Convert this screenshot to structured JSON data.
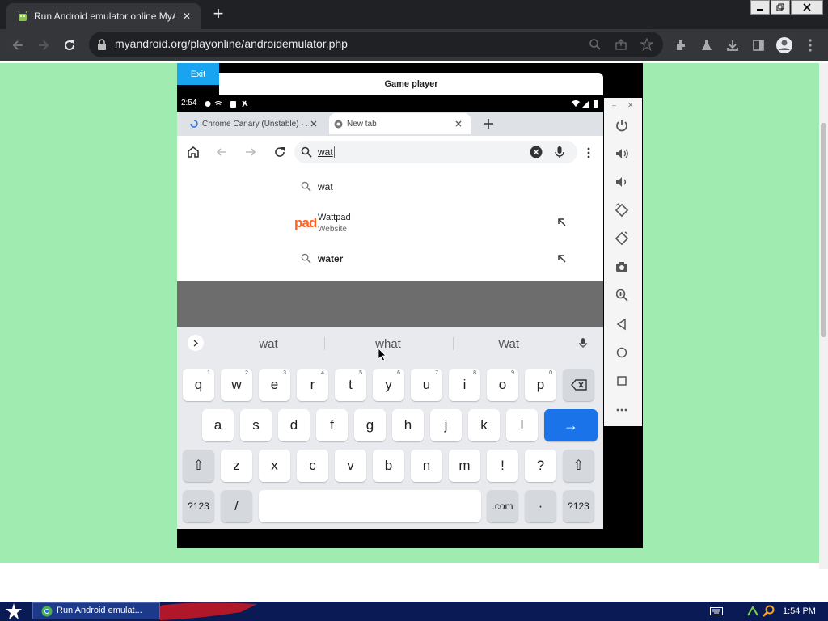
{
  "browser": {
    "tab_title": "Run Android emulator online MyAnd",
    "url": "myandroid.org/playonline/androidemulator.php",
    "new_tab_symbol": "+",
    "close_symbol": "✕"
  },
  "page": {
    "exit_label": "Exit",
    "game_player_title": "Game player"
  },
  "android": {
    "time": "2:54",
    "tabs": [
      {
        "label": "Chrome Canary (Unstable) · ..."
      },
      {
        "label": "New tab"
      }
    ],
    "search_value": "wat",
    "suggestions": [
      {
        "text": "wat",
        "subtext": "",
        "icon": "search-icon"
      },
      {
        "text": "Wattpad",
        "subtext": "Website",
        "icon": "wattpad-logo"
      },
      {
        "text": "water",
        "subtext": "",
        "icon": "search-icon"
      }
    ],
    "keyboard": {
      "candidates": [
        "wat",
        "what",
        "Wat"
      ],
      "row1": [
        {
          "k": "q",
          "s": "1"
        },
        {
          "k": "w",
          "s": "2"
        },
        {
          "k": "e",
          "s": "3"
        },
        {
          "k": "r",
          "s": "4"
        },
        {
          "k": "t",
          "s": "5"
        },
        {
          "k": "y",
          "s": "6"
        },
        {
          "k": "u",
          "s": "7"
        },
        {
          "k": "i",
          "s": "8"
        },
        {
          "k": "o",
          "s": "9"
        },
        {
          "k": "p",
          "s": "0"
        }
      ],
      "row2": [
        "a",
        "s",
        "d",
        "f",
        "g",
        "h",
        "j",
        "k",
        "l"
      ],
      "row3": [
        "z",
        "x",
        "c",
        "v",
        "b",
        "n",
        "m",
        "!",
        "?"
      ],
      "symbols_label": "?123",
      "slash_label": "/",
      "com_label": ".com",
      "dot_label": "·",
      "enter_symbol": "→",
      "shift_symbol": "⇧"
    }
  },
  "side_panel": {
    "icons": [
      "power-icon",
      "volume-up-icon",
      "volume-down-icon",
      "rotate-left-icon",
      "rotate-right-icon",
      "camera-icon",
      "zoom-icon",
      "back-icon",
      "home-icon",
      "overview-icon",
      "more-icon"
    ]
  },
  "taskbar": {
    "task_label": "Run Android emulat...",
    "time": "1:54 PM"
  },
  "colors": {
    "page_background": "#a0ebaf",
    "exit_button": "#18a4f0",
    "enter_key": "#1a73e8",
    "taskbar": "#0a1a55"
  }
}
